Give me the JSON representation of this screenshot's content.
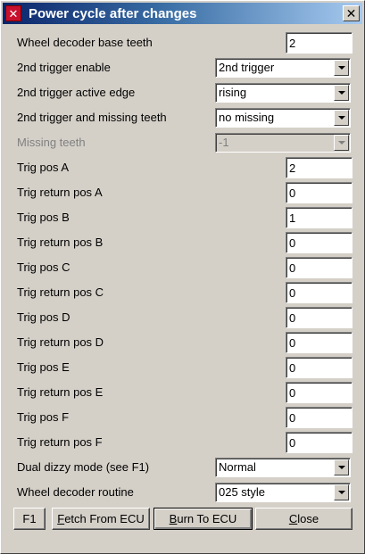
{
  "window": {
    "title": "Power cycle after changes",
    "close_glyph": "✕",
    "app_icon": "app-logo-icon"
  },
  "fields": [
    {
      "label": "Wheel decoder base teeth",
      "type": "text",
      "value": "2"
    },
    {
      "label": "2nd trigger enable",
      "type": "select",
      "value": "2nd trigger"
    },
    {
      "label": "2nd trigger active edge",
      "type": "select",
      "value": "rising"
    },
    {
      "label": "2nd trigger and missing teeth",
      "type": "select",
      "value": "no missing"
    },
    {
      "label": "Missing teeth",
      "type": "select",
      "value": "-1",
      "disabled": true
    },
    {
      "label": "Trig pos A",
      "type": "text",
      "value": "2"
    },
    {
      "label": "Trig return pos A",
      "type": "text",
      "value": "0"
    },
    {
      "label": "Trig pos B",
      "type": "text",
      "value": "1"
    },
    {
      "label": "Trig return pos B",
      "type": "text",
      "value": "0"
    },
    {
      "label": "Trig pos C",
      "type": "text",
      "value": "0"
    },
    {
      "label": "Trig return pos C",
      "type": "text",
      "value": "0"
    },
    {
      "label": "Trig pos D",
      "type": "text",
      "value": "0"
    },
    {
      "label": "Trig return pos D",
      "type": "text",
      "value": "0"
    },
    {
      "label": "Trig pos E",
      "type": "text",
      "value": "0"
    },
    {
      "label": "Trig return pos E",
      "type": "text",
      "value": "0"
    },
    {
      "label": "Trig pos F",
      "type": "text",
      "value": "0"
    },
    {
      "label": "Trig return pos F",
      "type": "text",
      "value": "0"
    },
    {
      "label": "Dual dizzy mode (see F1)",
      "type": "select",
      "value": "Normal"
    },
    {
      "label": "Wheel decoder routine",
      "type": "select",
      "value": "025 style"
    }
  ],
  "buttons": {
    "f1": "F1",
    "fetch_first": "F",
    "fetch_rest": "etch From ECU",
    "burn_first": "B",
    "burn_rest": "urn To ECU",
    "close_first": "C",
    "close_rest": "lose"
  }
}
